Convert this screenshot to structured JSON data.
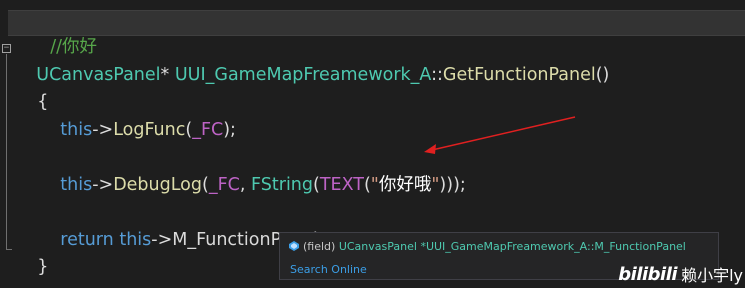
{
  "editor": {
    "comment_line": {
      "text": "//你好"
    },
    "signature": {
      "return_type": "UCanvasPanel",
      "pointer": "*",
      "class_name": "UUI_GameMapFreamework_A",
      "scope_op": "::",
      "function_name": "GetFunctionPanel",
      "params": "()"
    },
    "open_brace": "{",
    "line_logfunc": {
      "this_kw": "this",
      "arrow": "->",
      "func": "LogFunc",
      "open": "(",
      "arg": "_FC",
      "close": ");"
    },
    "line_debuglog": {
      "this_kw": "this",
      "arrow": "->",
      "func": "DebugLog",
      "open": "(",
      "arg": "_FC",
      "comma": ", ",
      "fstring": "FString",
      "paren_open": "(",
      "text_macro": "TEXT",
      "macro_open": "(",
      "string_quote_open": "\"",
      "string_value": "你好哦",
      "string_quote_close": "\"",
      "closing": ")));"
    },
    "line_return": {
      "return_kw": "return",
      "space": " ",
      "this_kw": "this",
      "arrow": "->",
      "member": "M_FunctionPanel",
      "semicolon": ";"
    },
    "close_brace": "}",
    "collapse_glyph": "−"
  },
  "tooltip": {
    "kind": "(field)",
    "type": "UCanvasPanel",
    "qualified": "*UUI_GameMapFreamework_A::M_FunctionPanel",
    "search_link": "Search Online"
  },
  "watermark": {
    "logo": "bilibili",
    "name": "赖小宇ly"
  },
  "colors": {
    "background": "#1e1e1e",
    "comment": "#57a64a",
    "type": "#4ec9b0",
    "function": "#dcdcaa",
    "keyword": "#569cd6",
    "macro": "#bd63c5",
    "string": "#d69d85",
    "arrow_annotation": "#e02020",
    "link": "#3b9ee6"
  },
  "icons": {
    "field_icon": "field-icon",
    "collapse_icon": "collapse-icon",
    "annotation_arrow": "red-arrow-icon"
  }
}
